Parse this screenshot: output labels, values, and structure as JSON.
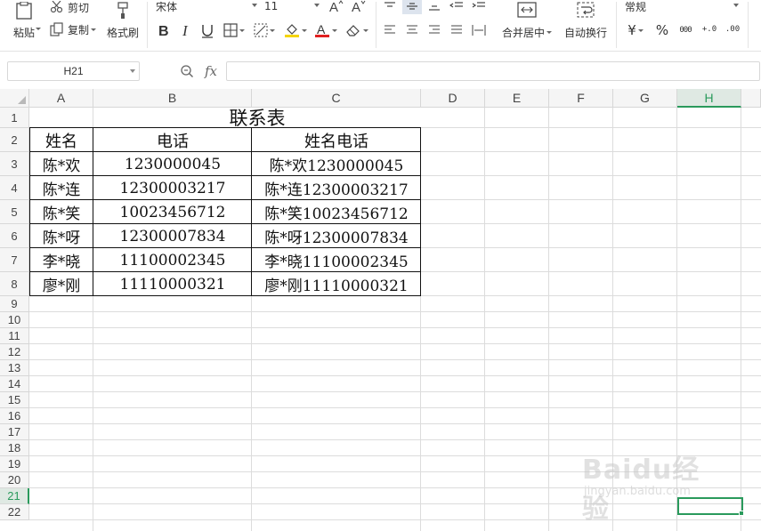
{
  "ribbon": {
    "paste_label": "粘贴",
    "cut_label": "剪切",
    "copy_label": "复制",
    "format_painter_label": "格式刷",
    "font_name": "宋体",
    "font_size": "11",
    "merge_center_label": "合并居中",
    "wrap_text_label": "自动换行",
    "number_format": "常规",
    "currency_symbol": "¥",
    "percent_symbol": "%",
    "thousands_symbol": "000",
    "increase_decimal_label": "+.0",
    "decrease_decimal_label": ".00"
  },
  "formula_bar": {
    "name_box": "H21",
    "fx_label": "fx",
    "formula": ""
  },
  "grid": {
    "columns": [
      "A",
      "B",
      "C",
      "D",
      "E",
      "F",
      "G",
      "H"
    ],
    "rows": [
      "1",
      "2",
      "3",
      "4",
      "5",
      "6",
      "7",
      "8",
      "9",
      "10",
      "11",
      "12",
      "13",
      "14",
      "15",
      "16",
      "17",
      "18",
      "19",
      "20",
      "21",
      "22"
    ],
    "selected_column": "H",
    "selected_row": "21",
    "selected_cell": "H21"
  },
  "table": {
    "title": "联系表",
    "headers": [
      "姓名",
      "电话",
      "姓名电话"
    ],
    "rows": [
      [
        "陈*欢",
        "1230000045",
        "陈*欢1230000045"
      ],
      [
        "陈*连",
        "12300003217",
        "陈*连12300003217"
      ],
      [
        "陈*笑",
        "10023456712",
        "陈*笑10023456712"
      ],
      [
        "陈*呀",
        "12300007834",
        "陈*呀12300007834"
      ],
      [
        "李*晓",
        "11100002345",
        "李*晓11100002345"
      ],
      [
        "廖*刚",
        "11110000321",
        "廖*刚11110000321"
      ]
    ]
  },
  "watermark": {
    "text": "Baidu经验",
    "url": "jingyan.baidu.com"
  },
  "colors": {
    "accent": "#2a9a5c",
    "grid_line": "#dcdcdc",
    "header_bg": "#f5f5f5"
  }
}
